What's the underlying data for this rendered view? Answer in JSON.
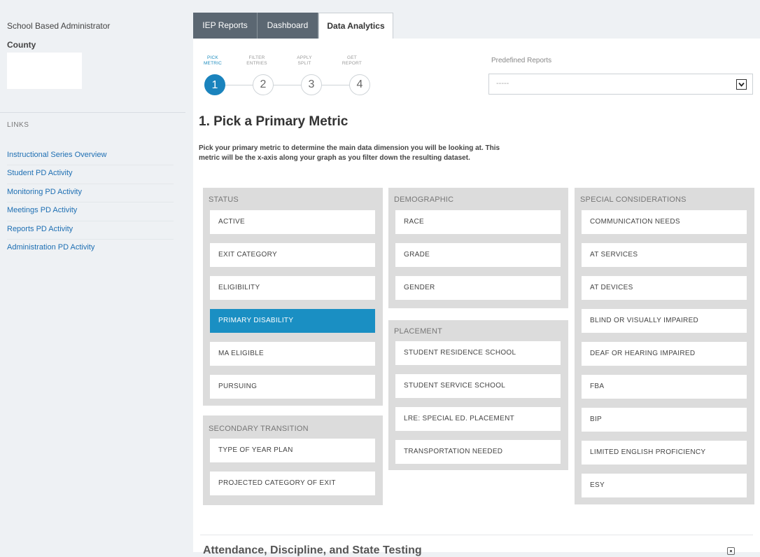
{
  "sidebar": {
    "role": "School Based Administrator",
    "county_label": "County",
    "links_heading": "LINKS",
    "links": [
      "Instructional Series Overview",
      "Student PD Activity",
      "Monitoring PD Activity",
      "Meetings PD Activity",
      "Reports PD Activity",
      "Administration PD Activity"
    ]
  },
  "tabs": [
    "IEP Reports",
    "Dashboard",
    "Data Analytics"
  ],
  "steps": [
    {
      "label": "PICK METRIC",
      "number": "1"
    },
    {
      "label": "FILTER ENTRIES",
      "number": "2"
    },
    {
      "label": "APPLY SPLIT",
      "number": "3"
    },
    {
      "label": "GET REPORT",
      "number": "4"
    }
  ],
  "predefined_reports": {
    "label": "Predefined Reports",
    "value": "-----"
  },
  "heading": "1. Pick a Primary Metric",
  "description": "Pick your primary metric to determine the main data dimension you will be looking at. This metric will be the x-axis along your graph as you filter down the resulting dataset.",
  "categories": {
    "status": {
      "title": "STATUS",
      "items": [
        "ACTIVE",
        "EXIT CATEGORY",
        "ELIGIBILITY",
        "PRIMARY DISABILITY",
        "MA ELIGIBLE",
        "PURSUING"
      ]
    },
    "secondary_transition": {
      "title": "SECONDARY TRANSITION",
      "items": [
        "TYPE OF YEAR PLAN",
        "PROJECTED CATEGORY OF EXIT"
      ]
    },
    "demographic": {
      "title": "DEMOGRAPHIC",
      "items": [
        "RACE",
        "GRADE",
        "GENDER"
      ]
    },
    "placement": {
      "title": "PLACEMENT",
      "items": [
        "STUDENT RESIDENCE SCHOOL",
        "STUDENT SERVICE SCHOOL",
        "LRE: SPECIAL ED. PLACEMENT",
        "TRANSPORTATION NEEDED"
      ]
    },
    "special_considerations": {
      "title": "SPECIAL CONSIDERATIONS",
      "items": [
        "COMMUNICATION NEEDS",
        "AT SERVICES",
        "AT DEVICES",
        "BLIND OR VISUALLY IMPAIRED",
        "DEAF OR HEARING IMPAIRED",
        "FBA",
        "BIP",
        "LIMITED ENGLISH PROFICIENCY",
        "ESY"
      ]
    }
  },
  "selected_metric": "PRIMARY DISABILITY",
  "bottom_section_title": "Attendance, Discipline, and State Testing"
}
